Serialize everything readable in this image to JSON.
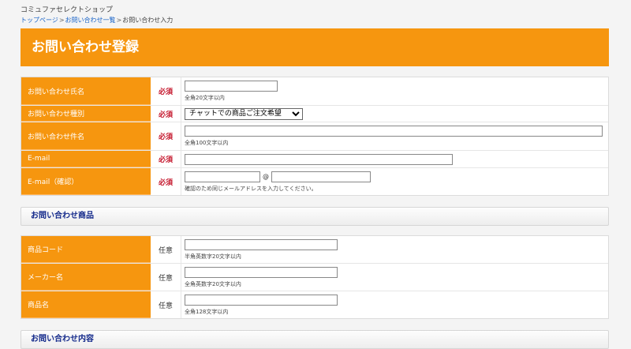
{
  "header": {
    "shop_name": "コミュファセレクトショップ",
    "breadcrumb": [
      "トップページ",
      "お問い合わせ一覧",
      "お問い合わせ入力"
    ],
    "breadcrumb_sep": ">",
    "title": "お問い合わせ登録"
  },
  "contact": {
    "name": {
      "label": "お問い合わせ氏名",
      "badge": "必須",
      "value": "",
      "note": "全角20文字以内"
    },
    "type": {
      "label": "お問い合わせ種別",
      "badge": "必須",
      "selected": "チャットでの商品ご注文希望"
    },
    "subject": {
      "label": "お問い合わせ件名",
      "badge": "必須",
      "value": "",
      "note": "全角100文字以内"
    },
    "email": {
      "label": "E-mail",
      "badge": "必須",
      "value": ""
    },
    "email_confirm": {
      "label": "E-mail（確認）",
      "badge": "必須",
      "local": "",
      "at": "@",
      "domain": "",
      "note": "確認のため同じメールアドレスを入力してください。"
    }
  },
  "product_section": {
    "title": "お問い合わせ商品",
    "code": {
      "label": "商品コード",
      "badge": "任意",
      "value": "",
      "note": "半角英数字20文字以内"
    },
    "maker": {
      "label": "メーカー名",
      "badge": "任意",
      "value": "",
      "note": "全角英数字20文字以内"
    },
    "product_name": {
      "label": "商品名",
      "badge": "任意",
      "value": "",
      "note": "全角128文字以内"
    }
  },
  "content_section": {
    "title": "お問い合わせ内容"
  },
  "colors": {
    "accent": "#f6960f",
    "required": "#c4142a",
    "section_title": "#12288a",
    "link": "#1a64c8"
  }
}
